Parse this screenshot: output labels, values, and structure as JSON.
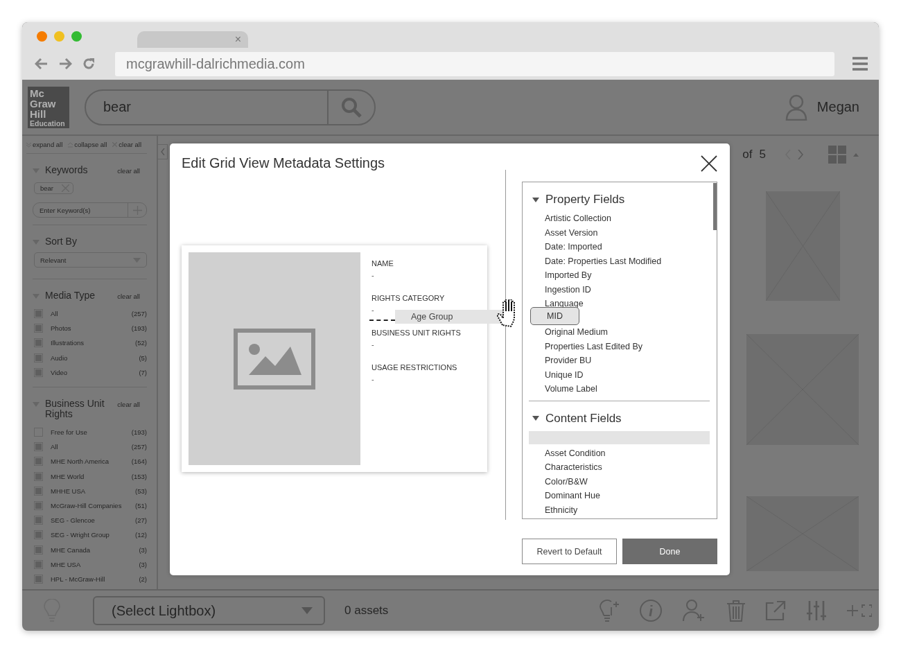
{
  "browser": {
    "tab_close": "×",
    "url": "mcgrawhill-dalrichmedia.com"
  },
  "header": {
    "logo": [
      "Mc",
      "Graw",
      "Hill",
      "Education"
    ],
    "search": {
      "value": "bear"
    },
    "user": "Megan"
  },
  "sidebar": {
    "actions": [
      {
        "kind": "expand",
        "label": "expand all"
      },
      {
        "kind": "collapse",
        "label": "collapse all"
      },
      {
        "kind": "clear",
        "label": "clear all"
      }
    ],
    "sections": [
      {
        "kind": "keywords",
        "title": "Keywords",
        "expanded": true,
        "clear": "clear all",
        "tags": [
          "bear"
        ],
        "placeholder": "Enter Keyword(s)"
      },
      {
        "kind": "select",
        "title": "Sort By",
        "expanded": true,
        "value": "Relevant"
      },
      {
        "kind": "checklist",
        "title": "Media Type",
        "expanded": true,
        "clear": "clear all",
        "items": [
          {
            "label": "All",
            "count": "(257)",
            "checked": true
          },
          {
            "label": "Photos",
            "count": "(193)",
            "checked": true
          },
          {
            "label": "Illustrations",
            "count": "(52)",
            "checked": true
          },
          {
            "label": "Audio",
            "count": "(5)",
            "checked": true
          },
          {
            "label": "Video",
            "count": "(7)",
            "checked": true
          }
        ]
      },
      {
        "kind": "checklist",
        "title": "Business Unit Rights",
        "expanded": true,
        "clear": "clear all",
        "items": [
          {
            "label": "Free for Use",
            "count": "(193)",
            "checked": false
          },
          {
            "label": "All",
            "count": "(257)",
            "checked": true
          },
          {
            "label": "MHE North America",
            "count": "(164)",
            "checked": true
          },
          {
            "label": "MHE World",
            "count": "(153)",
            "checked": true
          },
          {
            "label": "MHHE USA",
            "count": "(53)",
            "checked": true
          },
          {
            "label": "McGraw-Hill Companies",
            "count": "(51)",
            "checked": true
          },
          {
            "label": "SEG - Glencoe",
            "count": "(27)",
            "checked": true
          },
          {
            "label": "SEG - Wright Group",
            "count": "(12)",
            "checked": true
          },
          {
            "label": "MHE Canada",
            "count": "(3)",
            "checked": true
          },
          {
            "label": "MHE USA",
            "count": "(3)",
            "checked": true
          },
          {
            "label": "HPL - McGraw-Hill",
            "count": "(2)",
            "checked": true
          }
        ]
      }
    ]
  },
  "pager": {
    "of": "of",
    "total": "5"
  },
  "modal": {
    "title": "Edit Grid View Metadata Settings",
    "fields": [
      {
        "label": "NAME",
        "value": "-"
      },
      {
        "label": "RIGHTS CATEGORY",
        "value": "-"
      },
      {
        "label": "BUSINESS UNIT RIGHTS",
        "value": "-"
      },
      {
        "label": "USAGE RESTRICTIONS",
        "value": "-"
      }
    ],
    "dragged_field": "Age Group",
    "groups": [
      {
        "title": "Property Fields",
        "expanded": true,
        "items": [
          {
            "kind": "field",
            "label": "Artistic Collection",
            "selected": false
          },
          {
            "kind": "field",
            "label": "Asset Version",
            "selected": false
          },
          {
            "kind": "field",
            "label": "Date: Imported",
            "selected": false
          },
          {
            "kind": "field",
            "label": "Date: Properties Last Modified",
            "selected": false
          },
          {
            "kind": "field",
            "label": "Imported By",
            "selected": false
          },
          {
            "kind": "field",
            "label": "Ingestion ID",
            "selected": false
          },
          {
            "kind": "field",
            "label": "Language",
            "selected": false
          },
          {
            "kind": "field",
            "label": "MID",
            "selected": true
          },
          {
            "kind": "field",
            "label": "Original Medium",
            "selected": false
          },
          {
            "kind": "field",
            "label": "Properties Last Edited By",
            "selected": false
          },
          {
            "kind": "field",
            "label": "Provider BU",
            "selected": false
          },
          {
            "kind": "field",
            "label": "Unique ID",
            "selected": false
          },
          {
            "kind": "field",
            "label": "Volume Label",
            "selected": false
          }
        ]
      },
      {
        "title": "Content Fields",
        "expanded": true,
        "items": [
          {
            "kind": "drop_slot"
          },
          {
            "kind": "field",
            "label": "Asset Condition",
            "selected": false
          },
          {
            "kind": "field",
            "label": "Characteristics",
            "selected": false
          },
          {
            "kind": "field",
            "label": "Color/B&W",
            "selected": false
          },
          {
            "kind": "field",
            "label": "Dominant Hue",
            "selected": false
          },
          {
            "kind": "field",
            "label": "Ethnicity",
            "selected": false
          }
        ]
      }
    ],
    "buttons": [
      {
        "kind": "secondary",
        "label": "Revert to Default"
      },
      {
        "kind": "primary",
        "label": "Done"
      }
    ]
  },
  "bottom_bar": {
    "lightbox": {
      "value": "(Select Lightbox)"
    },
    "assets": "0 assets"
  }
}
